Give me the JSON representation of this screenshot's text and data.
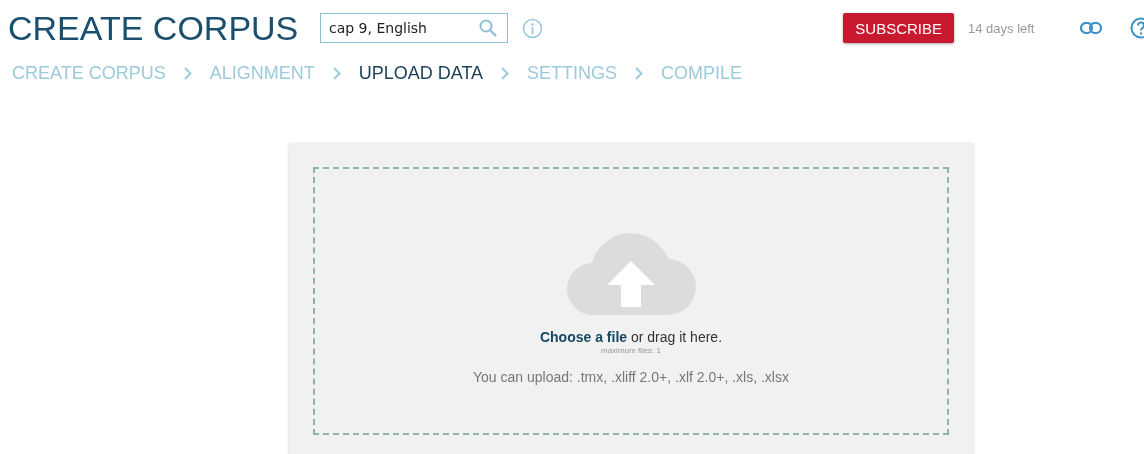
{
  "header": {
    "title": "CREATE CORPUS",
    "search": {
      "value": "cap 9, English"
    },
    "subscribe": "SUBSCRIBE",
    "trial": "14 days left"
  },
  "steps": [
    {
      "label": "CREATE CORPUS",
      "selected": false
    },
    {
      "label": "ALIGNMENT",
      "selected": false
    },
    {
      "label": "UPLOAD DATA",
      "selected": true
    },
    {
      "label": "SETTINGS",
      "selected": false
    },
    {
      "label": "COMPILE",
      "selected": false
    }
  ],
  "dropzone": {
    "link": "Choose a file",
    "text": "or drag it here.",
    "limit": "maximum files: 1",
    "formats": "You can upload: .tmx, .xliff 2.0+, .xlf 2.0+, .xls, .xlsx"
  }
}
